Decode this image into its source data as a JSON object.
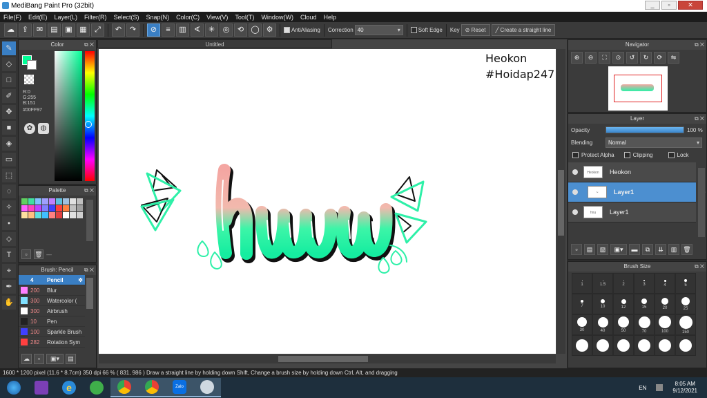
{
  "window": {
    "title": "MediBang Paint Pro (32bit)",
    "min": "_",
    "max": "▫",
    "close": "✕"
  },
  "menu": [
    "File(F)",
    "Edit(E)",
    "Layer(L)",
    "Filter(R)",
    "Select(S)",
    "Snap(N)",
    "Color(C)",
    "View(V)",
    "Tool(T)",
    "Window(W)",
    "Cloud",
    "Help"
  ],
  "toolbar": {
    "antialias_label": "AntiAliasing",
    "correction_label": "Correction",
    "correction_value": "40",
    "soft_edge_label": "Soft Edge",
    "key_label": "Key",
    "reset_label": "Reset",
    "straight_line_label": "Create a straight line"
  },
  "color_panel": {
    "title": "Color",
    "r": "R:0",
    "g": "G:255",
    "b": "B:151",
    "hex": "#00FF97",
    "fg_color": "#00ff97"
  },
  "palette_panel": {
    "title": "Palette",
    "colors": [
      "#60d060",
      "#40e0a0",
      "#80c0ff",
      "#a0a0ff",
      "#c080ff",
      "#60c0e0",
      "#a0c0e0",
      "#e0e0e0",
      "#c0c0c0",
      "#ff60ff",
      "#ff40c0",
      "#c040ff",
      "#8080ff",
      "#4040ff",
      "#ff4040",
      "#ff8040",
      "#c0c0c0",
      "#a0a0a0",
      "#ffe0a0",
      "#ffc080",
      "#60e0e0",
      "#40c0ff",
      "#ff8080",
      "#e04040",
      "#ffffff",
      "#e0e0e0",
      "#d0d0d0"
    ],
    "more": "---"
  },
  "brush_panel": {
    "title": "Brush: Pencil",
    "items": [
      {
        "size": "4",
        "name": "Pencil",
        "color": "#3a7fc4"
      },
      {
        "size": "200",
        "name": "Blur",
        "color": "#ff80ff"
      },
      {
        "size": "300",
        "name": "Watercolor (",
        "color": "#80e0ff"
      },
      {
        "size": "300",
        "name": "Airbrush",
        "color": "#ffffff"
      },
      {
        "size": "10",
        "name": "Pen",
        "color": "#222222"
      },
      {
        "size": "100",
        "name": "Sparkle Brush",
        "color": "#4040ff"
      },
      {
        "size": "282",
        "name": "Rotation Sym",
        "color": "#ff4040"
      }
    ]
  },
  "canvas": {
    "tab_title": "Untitled",
    "watermark_line1": "Heokon",
    "watermark_line2": "#Hoidap247"
  },
  "navigator_panel": {
    "title": "Navigator"
  },
  "layer_panel": {
    "title": "Layer",
    "opacity_label": "Opacity",
    "opacity_value": "100 %",
    "opacity_fraction": 1.0,
    "blending_label": "Blending",
    "blending_value": "Normal",
    "protect_alpha": "Protect Alpha",
    "clipping": "Clipping",
    "lock": "Lock",
    "layers": [
      {
        "name": "Heokon",
        "selected": false,
        "thumb": "Heokon #Hoidap247"
      },
      {
        "name": "Layer1",
        "selected": true,
        "thumb": "~"
      },
      {
        "name": "Layer1",
        "selected": false,
        "thumb": "hnu"
      }
    ]
  },
  "brush_size_panel": {
    "title": "Brush Size",
    "sizes": [
      "1",
      "1.5",
      "2",
      "3",
      "4",
      "5",
      "7",
      "10",
      "12",
      "15",
      "20",
      "25",
      "30",
      "40",
      "50",
      "70",
      "100",
      "150",
      "",
      "",
      "",
      "",
      "",
      ""
    ]
  },
  "status": {
    "text": "1600 * 1200 pixel   (11.6 * 8.7cm)   350 dpi   66 %   ( 831, 986 )   Draw a straight line by holding down Shift, Change a brush size by holding down Ctrl, Alt, and dragging"
  },
  "taskbar": {
    "lang": "EN",
    "time": "8:05 AM",
    "date": "9/12/2021",
    "zalo_label": "Zalo"
  }
}
